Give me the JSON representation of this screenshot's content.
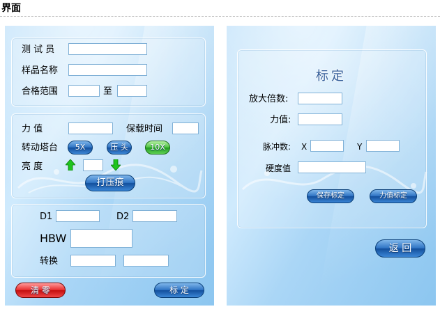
{
  "page_title": "界面",
  "left": {
    "tester_label": "测 试 员",
    "sample_name_label": "样品名称",
    "range_label": "合格范围",
    "range_to_label": "至",
    "force_label": "力    值",
    "hold_time_label": "保载时间",
    "turret_label": "转动塔台",
    "turret_5x": "5X",
    "turret_indent": "压 头",
    "turret_10x": "10X",
    "brightness_label": "亮 度",
    "indent_button": "打压痕",
    "d1_label": "D1",
    "d2_label": "D2",
    "hbw_label": "HBW",
    "convert_label": "转换",
    "clear_button": "清  零",
    "calibrate_button": "标  定"
  },
  "right": {
    "header": "标定",
    "magnification_label": "放大倍数:",
    "force_label": "力值:",
    "pulse_label": "脉冲数:",
    "x_label": "X",
    "y_label": "Y",
    "hardness_label": "硬度值",
    "save_calib_button": "保存标定",
    "force_calib_button": "力值标定",
    "back_button": "返 回"
  },
  "colors": {
    "panel_blue": "#aad6f6",
    "button_blue": "#2f74c4",
    "button_green": "#4fc343",
    "button_red": "#e83030",
    "arrow_green": "#1fc41f"
  }
}
